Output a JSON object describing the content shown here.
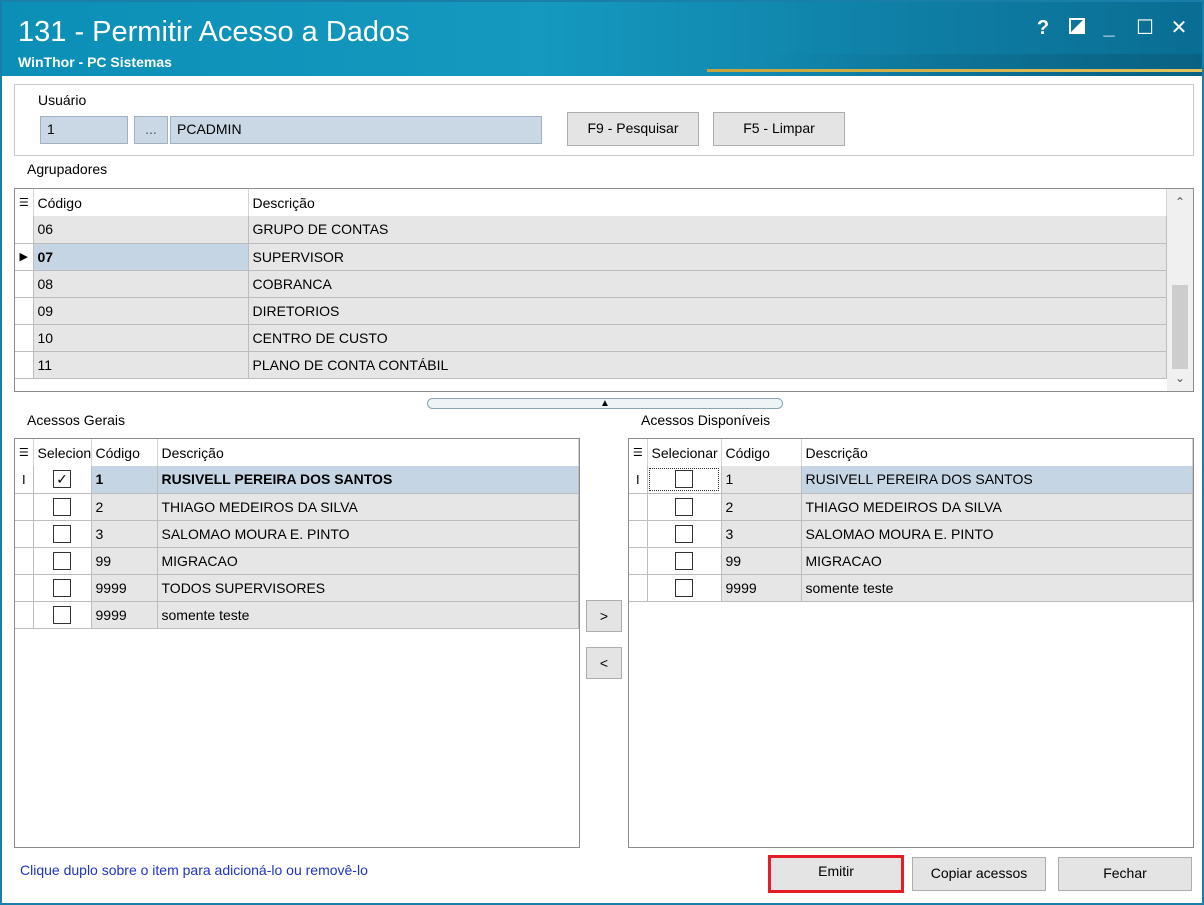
{
  "window": {
    "title": "131 - Permitir Acesso a Dados",
    "subtitle": "WinThor - PC Sistemas",
    "help_label": "?",
    "minimize_label": "_",
    "maximize_label": "☐",
    "close_label": "✕"
  },
  "usuario": {
    "label": "Usuário",
    "code": "1",
    "lookup_label": "...",
    "name": "PCADMIN",
    "search_button": "F9 - Pesquisar",
    "clear_button": "F5 - Limpar"
  },
  "agrupadores": {
    "label": "Agrupadores",
    "columns": [
      "Código",
      "Descrição"
    ],
    "rows": [
      {
        "codigo": "06",
        "descricao": "GRUPO DE CONTAS"
      },
      {
        "codigo": "07",
        "descricao": "SUPERVISOR"
      },
      {
        "codigo": "08",
        "descricao": "COBRANCA"
      },
      {
        "codigo": "09",
        "descricao": "DIRETORIOS"
      },
      {
        "codigo": "10",
        "descricao": "CENTRO DE CUSTO"
      },
      {
        "codigo": "11",
        "descricao": "PLANO DE CONTA CONTÁBIL"
      }
    ],
    "selected_index": 1
  },
  "acessos_gerais": {
    "label": "Acessos Gerais",
    "columns": [
      "Selecionar",
      "Código",
      "Descrição"
    ],
    "rows": [
      {
        "checked": true,
        "codigo": "1",
        "descricao": "RUSIVELL PEREIRA DOS SANTOS"
      },
      {
        "checked": false,
        "codigo": "2",
        "descricao": "THIAGO MEDEIROS DA SILVA"
      },
      {
        "checked": false,
        "codigo": "3",
        "descricao": "SALOMAO MOURA E. PINTO"
      },
      {
        "checked": false,
        "codigo": "99",
        "descricao": "MIGRACAO"
      },
      {
        "checked": false,
        "codigo": "9999",
        "descricao": "TODOS SUPERVISORES"
      },
      {
        "checked": false,
        "codigo": "9999",
        "descricao": "somente teste"
      }
    ]
  },
  "acessos_disponiveis": {
    "label": "Acessos Disponíveis",
    "columns": [
      "Selecionar",
      "Código",
      "Descrição"
    ],
    "rows": [
      {
        "checked": false,
        "codigo": "1",
        "descricao": "RUSIVELL PEREIRA DOS SANTOS"
      },
      {
        "checked": false,
        "codigo": "2",
        "descricao": "THIAGO MEDEIROS DA SILVA"
      },
      {
        "checked": false,
        "codigo": "3",
        "descricao": "SALOMAO MOURA E. PINTO"
      },
      {
        "checked": false,
        "codigo": "99",
        "descricao": "MIGRACAO"
      },
      {
        "checked": false,
        "codigo": "9999",
        "descricao": "somente teste"
      }
    ]
  },
  "transfer": {
    "add_label": ">",
    "remove_label": "<"
  },
  "footer": {
    "hint": "Clique duplo sobre o item para adicioná-lo ou removê-lo",
    "emitir": "Emitir",
    "copiar": "Copiar acessos",
    "fechar": "Fechar"
  },
  "colors": {
    "title_bar": "#1599bf",
    "selected_row": "#c5d5e4",
    "row_bg": "#e6e6e6",
    "highlight_border": "#e41e26",
    "hint_text": "#1f33c7"
  }
}
